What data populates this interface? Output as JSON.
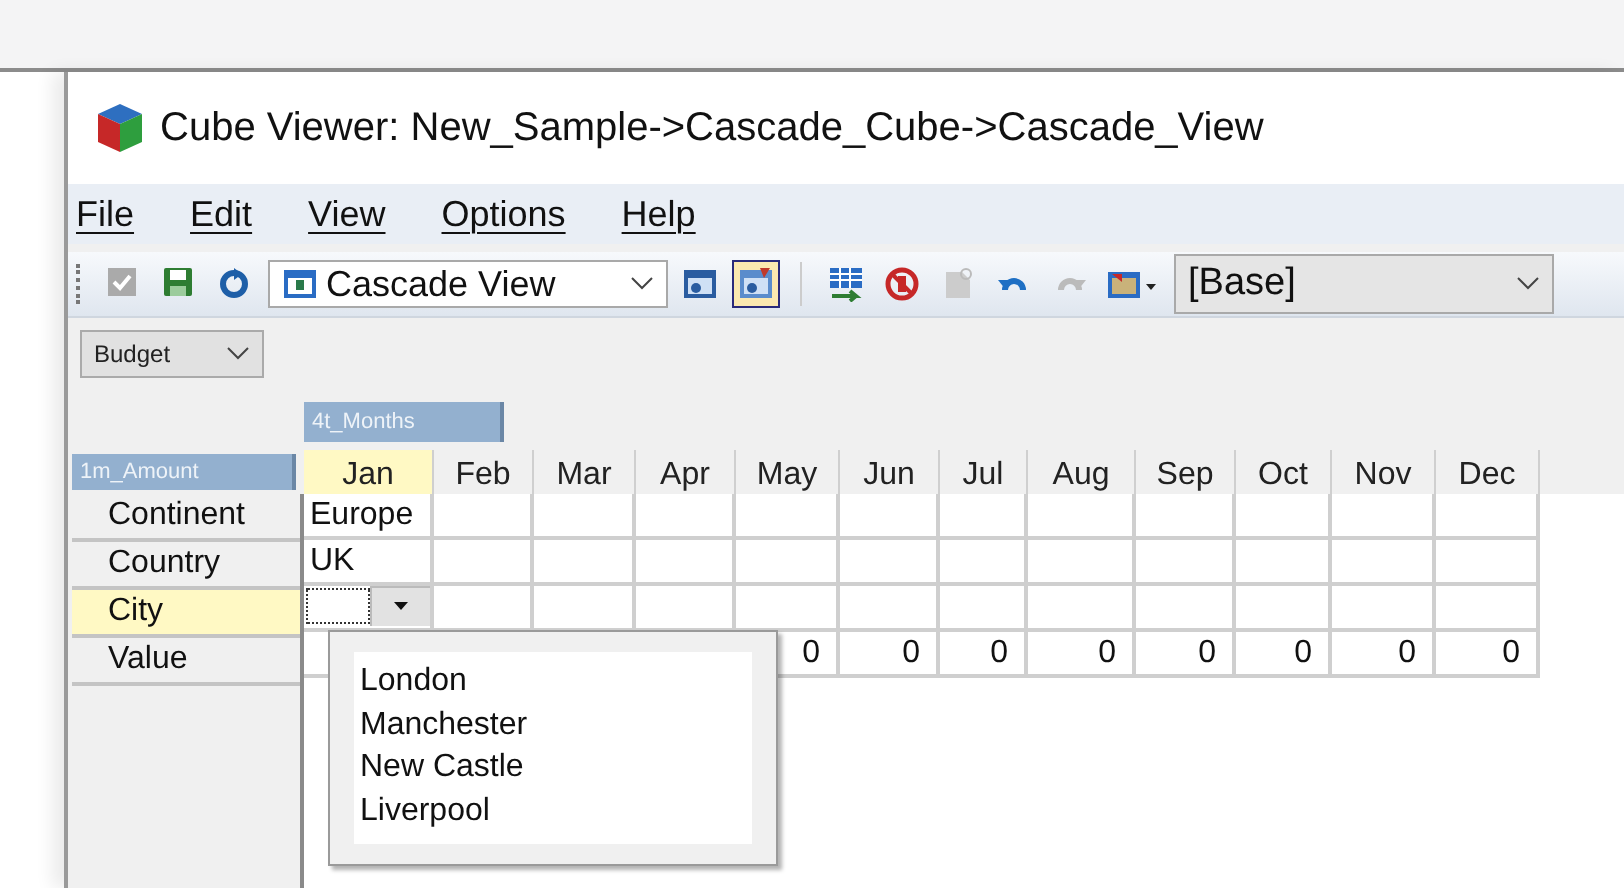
{
  "window": {
    "title": "Cube Viewer: New_Sample->Cascade_Cube->Cascade_View"
  },
  "menu": [
    {
      "label": "File"
    },
    {
      "label": "Edit"
    },
    {
      "label": "View"
    },
    {
      "label": "Options"
    },
    {
      "label": "Help"
    }
  ],
  "toolbar": {
    "buttons": [
      {
        "disabled": true
      },
      {
        "disabled": false
      },
      {
        "disabled": false
      }
    ],
    "view_select": {
      "value": "Cascade  View"
    },
    "view_buttons": [
      {
        "selected": false
      },
      {
        "selected": true
      }
    ],
    "action_buttons": [
      {
        "disabled": false
      },
      {
        "disabled": false
      },
      {
        "disabled": true
      },
      {
        "disabled": false
      },
      {
        "disabled": true
      },
      {
        "disabled": false
      }
    ],
    "subset_select": {
      "value": "[Base]"
    }
  },
  "title_dropdown": {
    "value": "Budget"
  },
  "column_dimension": {
    "label": "4t_Months"
  },
  "row_dimension": {
    "label": "1m_Amount"
  },
  "columns": [
    {
      "label": "Jan",
      "selected": true
    },
    {
      "label": "Feb",
      "selected": false
    },
    {
      "label": "Mar",
      "selected": false
    },
    {
      "label": "Apr",
      "selected": false
    },
    {
      "label": "May",
      "selected": false
    },
    {
      "label": "Jun",
      "selected": false
    },
    {
      "label": "Jul",
      "selected": false
    },
    {
      "label": "Aug",
      "selected": false
    },
    {
      "label": "Sep",
      "selected": false
    },
    {
      "label": "Oct",
      "selected": false
    },
    {
      "label": "Nov",
      "selected": false
    },
    {
      "label": "Dec",
      "selected": false
    }
  ],
  "rows": [
    {
      "label": "Continent",
      "selected": false,
      "kind": "text",
      "cells": [
        "Europe",
        null,
        null,
        null,
        null,
        null,
        null,
        null,
        null,
        null,
        null,
        null
      ]
    },
    {
      "label": "Country",
      "selected": false,
      "kind": "text",
      "cells": [
        "UK",
        null,
        null,
        null,
        null,
        null,
        null,
        null,
        null,
        null,
        null,
        null
      ]
    },
    {
      "label": "City",
      "selected": true,
      "kind": "combo",
      "cells": [
        null,
        null,
        null,
        null,
        null,
        null,
        null,
        null,
        null,
        null,
        null,
        null
      ],
      "combo": {
        "expanded": true,
        "options": [
          "London",
          "Manchester",
          "New Castle",
          "Liverpool"
        ]
      }
    },
    {
      "label": "Value",
      "selected": false,
      "kind": "number",
      "cells": [
        null,
        null,
        null,
        null,
        "0",
        "0",
        "0",
        "0",
        "0",
        "0",
        "0",
        "0"
      ]
    }
  ]
}
